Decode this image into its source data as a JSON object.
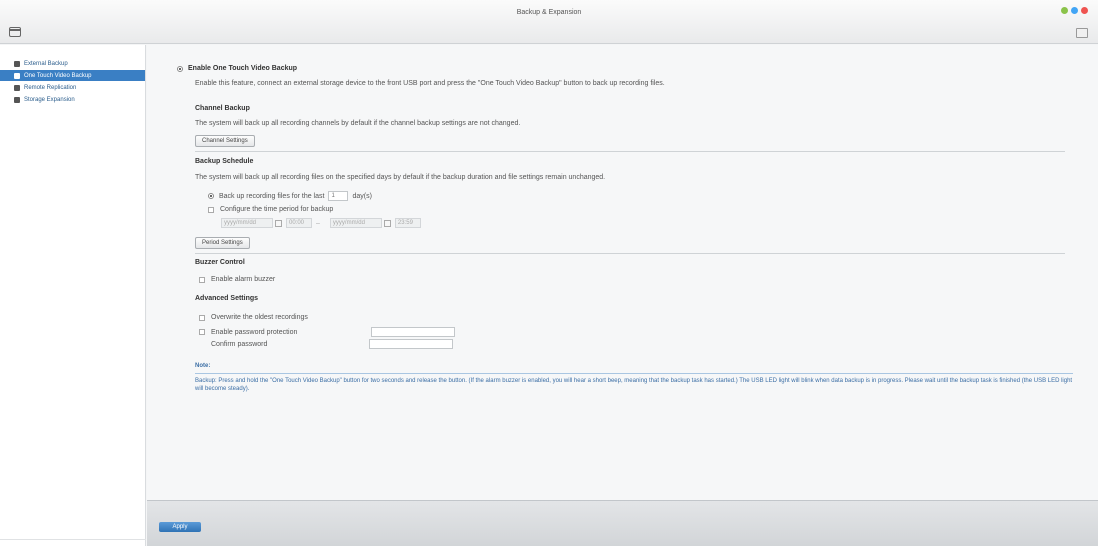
{
  "window": {
    "title": "Backup & Expansion"
  },
  "sidebar": {
    "items": [
      {
        "label": "External Backup",
        "icon": "disk-icon"
      },
      {
        "label": "One Touch Video Backup",
        "icon": "usb-icon",
        "active": true
      },
      {
        "label": "Remote Replication",
        "icon": "server-icon"
      },
      {
        "label": "Storage Expansion",
        "icon": "storage-icon"
      }
    ]
  },
  "main": {
    "enable_label": "Enable One Touch Video Backup",
    "enable_desc": "Enable this feature, connect an external storage device to the front USB port and press the \"One Touch Video Backup\" button to back up recording files.",
    "channel": {
      "heading": "Channel Backup",
      "desc": "The system will back up all recording channels by default if the channel backup settings are not changed.",
      "button": "Channel Settings"
    },
    "schedule": {
      "heading": "Backup Schedule",
      "desc": "The system will back up all recording files on the specified days by default if the backup duration and file settings remain unchanged.",
      "opt1_label": "Back up recording files for the last",
      "opt1_value": "1",
      "opt1_unit": "day(s)",
      "opt2_label": "Configure the time period for backup",
      "from_date": "yyyy/mm/dd",
      "from_time": "00:00",
      "to_date": "yyyy/mm/dd",
      "to_time": "23:59",
      "button": "Period Settings"
    },
    "buzzer": {
      "heading": "Buzzer Control",
      "option": "Enable alarm buzzer"
    },
    "advanced": {
      "heading": "Advanced Settings",
      "overwrite": "Overwrite the oldest recordings",
      "password": "Enable password protection",
      "confirm": "Confirm password"
    },
    "note": {
      "title": "Note:",
      "text": "Backup: Press and hold the \"One Touch Video Backup\" button for two seconds and release the button. (If the alarm buzzer is enabled, you will hear a short beep, meaning that the backup task has started.) The USB LED light will blink when data backup is in progress. Please wait until the backup task is finished (the USB LED light will become steady)."
    }
  },
  "footer": {
    "apply_label": "Apply"
  }
}
